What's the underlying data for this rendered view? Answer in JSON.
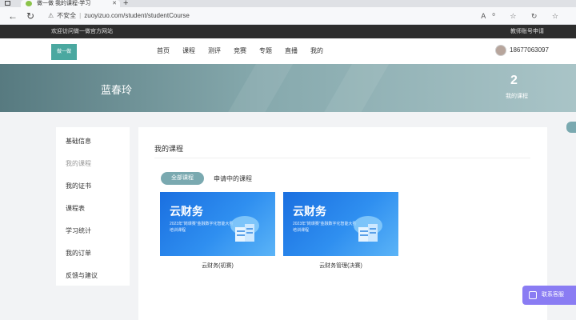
{
  "browser": {
    "tab_title": "做一做  我的课程-学习",
    "url_warning": "不安全",
    "url": "zuoyizuo.com/student/studentCourse",
    "right_tools": "A⁰ ☆ ↻ ☆"
  },
  "notice": {
    "left": "欢迎访问做一做官方网站",
    "right": "教师账号申请"
  },
  "header": {
    "logo": "做一做",
    "nav": [
      "首页",
      "课程",
      "测评",
      "竞赛",
      "专题",
      "直播",
      "我的"
    ],
    "phone": "18677063097"
  },
  "banner": {
    "user_name": "蓝春玲",
    "stat_value": "2",
    "stat_label": "我的课程"
  },
  "sidebar": {
    "items": [
      "基础信息",
      "我的课程",
      "我的证书",
      "课程表",
      "学习统计",
      "我的订单",
      "反馈与建议"
    ]
  },
  "main": {
    "title": "我的课程",
    "tab_all": "全部课程",
    "tab_other": "申请中的课程",
    "cards": [
      {
        "brand": "云财务",
        "sub": "2023年“岗课赛”金融数字化智能大赛",
        "sub2": "培训课程",
        "title": "云财务(初赛)"
      },
      {
        "brand": "云财务",
        "sub": "2023年“岗课赛”金融数字化智能大赛",
        "sub2": "培训课程",
        "title": "云财务管理(决赛)"
      }
    ]
  },
  "float_button": "联系客服"
}
